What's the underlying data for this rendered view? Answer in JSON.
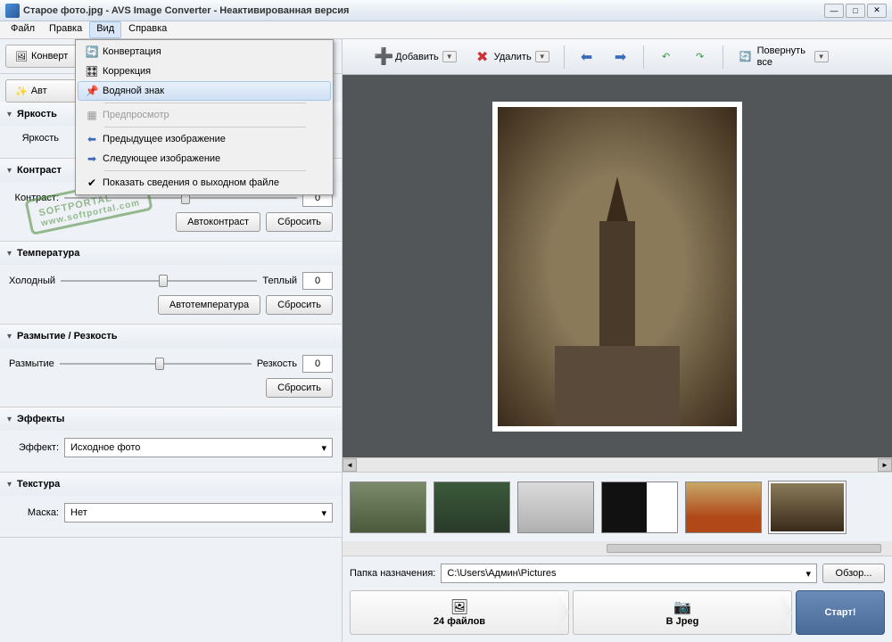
{
  "title": "Старое фото.jpg - AVS Image Converter - Неактивированная версия",
  "menubar": [
    "Файл",
    "Правка",
    "Вид",
    "Справка"
  ],
  "dropdown": {
    "items": [
      {
        "icon": "⚙",
        "label": "Конвертация"
      },
      {
        "icon": "🎨",
        "label": "Коррекция"
      },
      {
        "icon": "📌",
        "label": "Водяной знак",
        "hl": true
      },
      {
        "sep": true
      },
      {
        "icon": "",
        "label": "Предпросмотр",
        "disabled": true
      },
      {
        "sep": true
      },
      {
        "icon": "⬅",
        "label": "Предыдущее изображение"
      },
      {
        "icon": "➡",
        "label": "Следующее изображение"
      },
      {
        "sep": true
      },
      {
        "icon": "✔",
        "label": "Показать сведения о выходном файле"
      }
    ]
  },
  "sidebar": {
    "tab1": "Конверт",
    "tab2": "Авт",
    "brightness": {
      "title": "Яркость",
      "label": "Яркость"
    },
    "contrast": {
      "title": "Контраст",
      "label": "Контраст:",
      "value": "0",
      "auto": "Автоконтраст",
      "reset": "Сбросить"
    },
    "temperature": {
      "title": "Температура",
      "cold": "Холодный",
      "warm": "Теплый",
      "value": "0",
      "auto": "Автотемпература",
      "reset": "Сбросить"
    },
    "blur": {
      "title": "Размытие / Резкость",
      "blur": "Размытие",
      "sharp": "Резкость",
      "value": "0",
      "reset": "Сбросить"
    },
    "effects": {
      "title": "Эффекты",
      "label": "Эффект:",
      "value": "Исходное фото"
    },
    "texture": {
      "title": "Текстура",
      "label": "Маска:",
      "value": "Нет"
    }
  },
  "toolbar": {
    "add": "Добавить",
    "del": "Удалить",
    "rotate": "Повернуть все"
  },
  "bottom": {
    "dest_label": "Папка назначения:",
    "dest_value": "C:\\Users\\Админ\\Pictures",
    "browse": "Обзор...",
    "files_count": "24 файлов",
    "format": "В Jpeg",
    "start": "Старт!"
  },
  "watermark": {
    "brand": "SOFTPORTAL",
    "url": "www.softportal.com",
    "tm": "™"
  }
}
